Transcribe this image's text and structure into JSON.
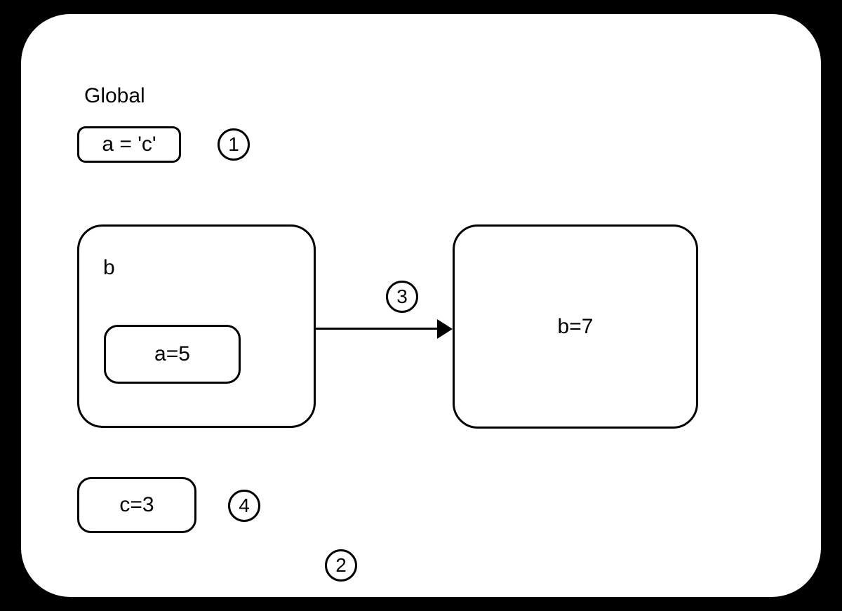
{
  "title": "Global",
  "boxes": {
    "a1": "a = 'c'",
    "scope_b_label": "b",
    "a5": "a=5",
    "b7": "b=7",
    "c3": "c=3"
  },
  "steps": {
    "s1": "1",
    "s2": "2",
    "s3": "3",
    "s4": "4"
  }
}
